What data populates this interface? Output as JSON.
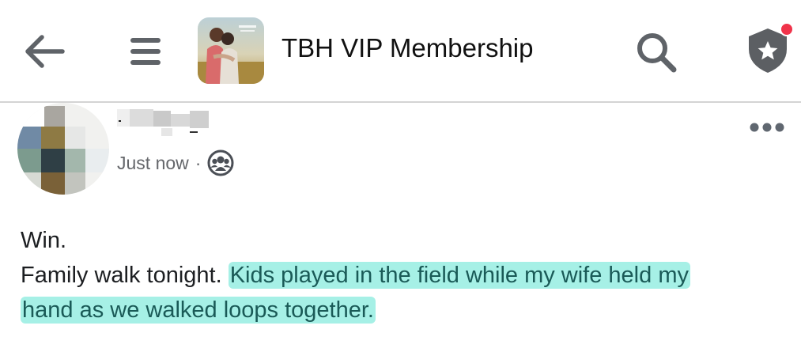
{
  "header": {
    "group_title": "TBH VIP Membership",
    "back_icon": "arrow-left-icon",
    "menu_icon": "hamburger-menu-icon",
    "search_icon": "search-icon",
    "badge_icon": "shield-star-icon",
    "notification_dot_color": "#f0334a"
  },
  "post": {
    "timestamp": "Just now",
    "separator": "·",
    "audience_icon": "group-audience-icon",
    "more_icon": "more-horizontal-icon",
    "body": {
      "line1": "Win.",
      "line2_plain": "Family walk tonight. ",
      "line2_highlight": "Kids played in the field while my wife held my",
      "line3_highlight": "hand as we walked loops together."
    },
    "highlight_color": "#a6f0e6"
  }
}
